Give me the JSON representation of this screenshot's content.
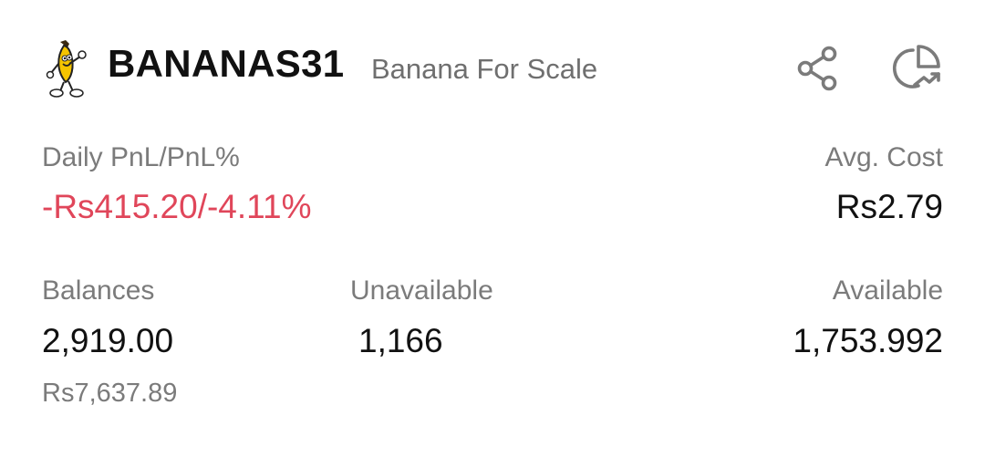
{
  "header": {
    "symbol": "BANANAS31",
    "name": "Banana For Scale",
    "logo_icon": "banana-mascot-icon",
    "share_icon": "share-icon",
    "chart_icon": "pie-chart-trend-icon"
  },
  "pnl": {
    "label": "Daily PnL/PnL%",
    "value": "-Rs415.20/-4.11%",
    "color": "#e0465a"
  },
  "avg_cost": {
    "label": "Avg. Cost",
    "value": "Rs2.79"
  },
  "balances": {
    "label": "Balances",
    "value": "2,919.00",
    "fiat_value": "Rs7,637.89"
  },
  "unavailable": {
    "label": "Unavailable",
    "value": "1,166"
  },
  "available": {
    "label": "Available",
    "value": "1,753.992"
  }
}
